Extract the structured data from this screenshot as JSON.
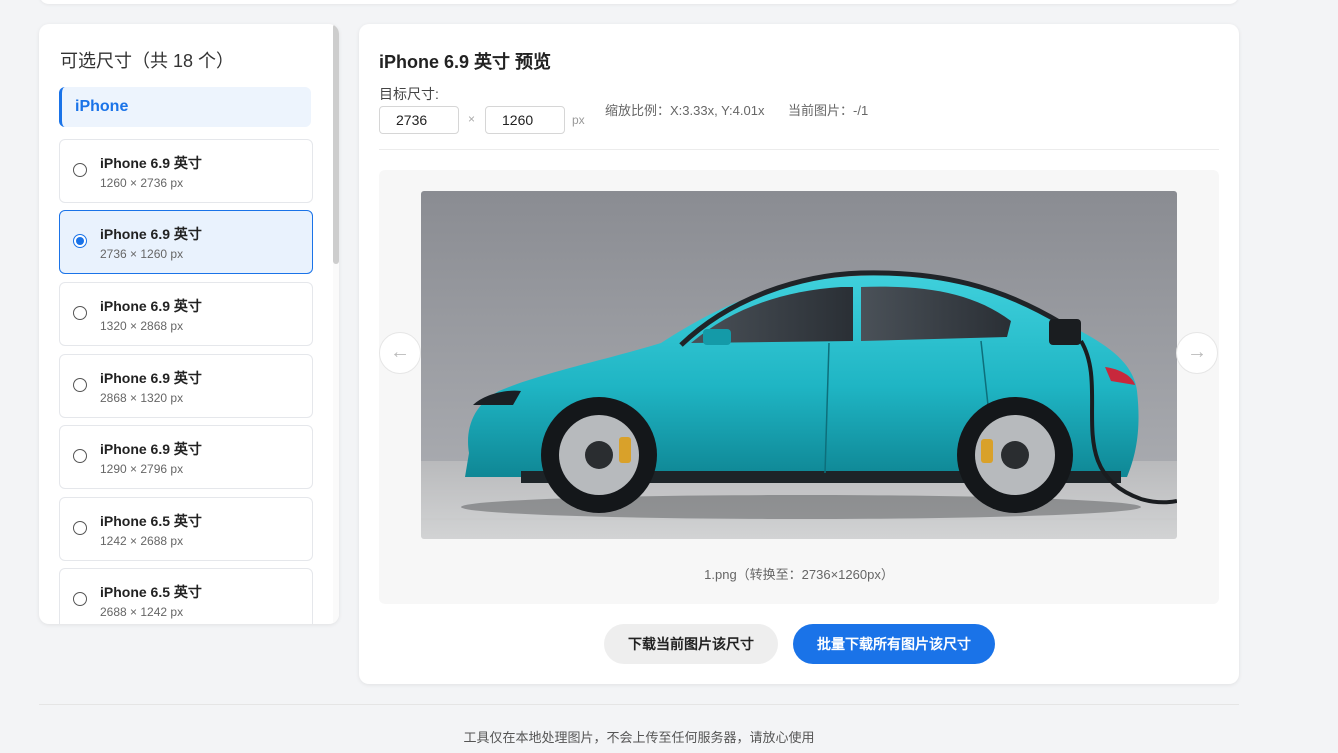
{
  "sidebar": {
    "title": "可选尺寸（共 18 个）",
    "category": "iPhone",
    "items": [
      {
        "name": "iPhone 6.9 英寸",
        "dims": "1260 × 2736 px",
        "selected": false
      },
      {
        "name": "iPhone 6.9 英寸",
        "dims": "2736 × 1260 px",
        "selected": true
      },
      {
        "name": "iPhone 6.9 英寸",
        "dims": "1320 × 2868 px",
        "selected": false
      },
      {
        "name": "iPhone 6.9 英寸",
        "dims": "2868 × 1320 px",
        "selected": false
      },
      {
        "name": "iPhone 6.9 英寸",
        "dims": "1290 × 2796 px",
        "selected": false
      },
      {
        "name": "iPhone 6.5 英寸",
        "dims": "1242 × 2688 px",
        "selected": false
      },
      {
        "name": "iPhone 6.5 英寸",
        "dims": "2688 × 1242 px",
        "selected": false
      }
    ]
  },
  "preview": {
    "title": "iPhone 6.9 英寸 预览",
    "target_label": "目标尺寸:",
    "width_value": "2736",
    "height_value": "1260",
    "times_sign": "×",
    "unit": "px",
    "scale_info": "缩放比例：X:3.33x, Y:4.01x",
    "current_info": "当前图片：-/1",
    "prev_arrow": "←",
    "next_arrow": "→",
    "caption": "1.png（转换至：2736×1260px）",
    "image_subject": "teal electric sedan charging in front of grey concrete wall"
  },
  "actions": {
    "download_current": "下载当前图片该尺寸",
    "download_all": "批量下载所有图片该尺寸"
  },
  "footer": {
    "notice": "工具仅在本地处理图片，不会上传至任何服务器，请放心使用"
  },
  "colors": {
    "accent": "#1a73e8",
    "page_background": "#f3f4f6",
    "car_body": "#1fb5c4"
  }
}
